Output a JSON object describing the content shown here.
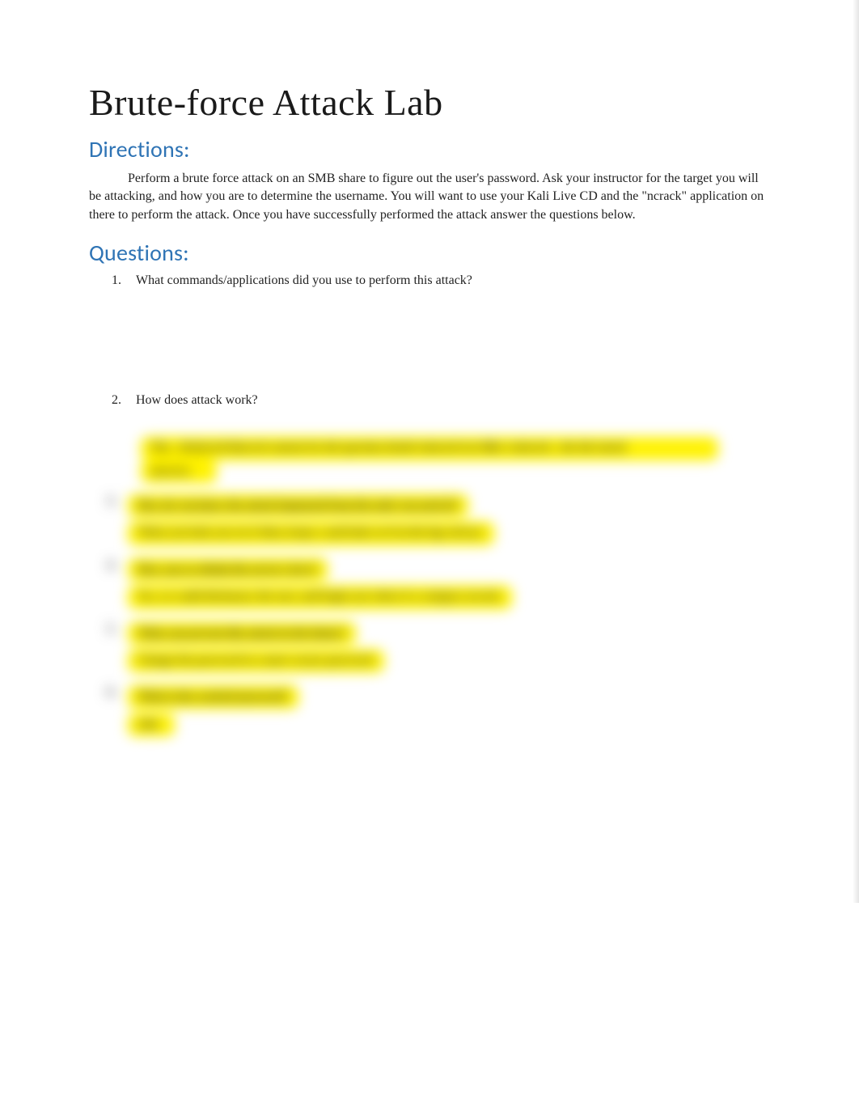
{
  "title": "Brute-force Attack Lab",
  "sections": {
    "directions_heading": "Directions:",
    "directions_body": "Perform a brute force attack on an SMB share to figure out the user's password.     Ask your instructor for the target you will be attacking, and how you are to determine the username.      You will want to use your Kali Live CD and the \"ncrack\" application on there to perform the attack.  Once you have successfully performed the attack answer the questions below.",
    "questions_heading": "Questions:",
    "questions": [
      "What commands/applications did you use to perform this attack?",
      "How does attack work?"
    ]
  },
  "blurred": {
    "intro_line1": "The…Redacted blurred content for lab question detail redacted text filler redacted…the lab attack",
    "intro_line2": "answers.",
    "items": [
      {
        "q": "How do you know the attack happened from the tools you used of?",
        "a": "When you look you see it then, keeps a and looks at it in the logs always."
      },
      {
        "q": "How can we obtain the server's keys?",
        "a": "Yes, we could dictionary the user, and begin you where it a category ncrack."
      },
      {
        "q": "What can prevent this attack in the future?",
        "a": "Change the password to a more secure password."
      },
      {
        "q": "What is the cracked password?",
        "a": "adm"
      }
    ]
  }
}
